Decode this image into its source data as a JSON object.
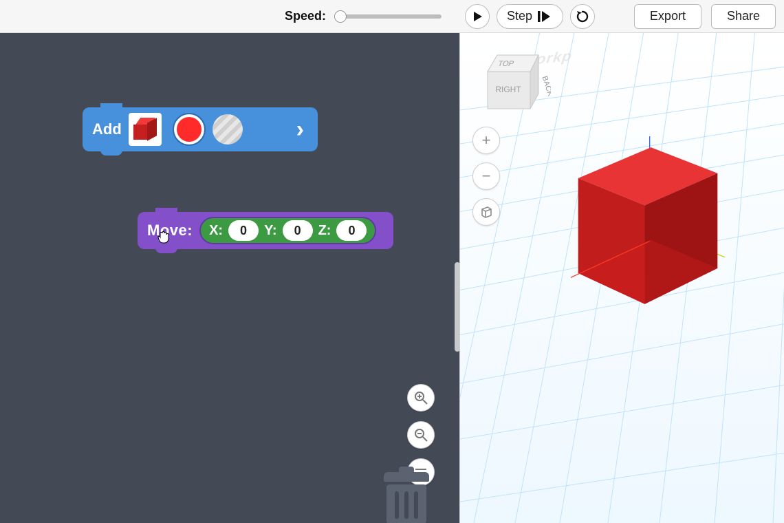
{
  "toolbar": {
    "speed_label": "Speed:",
    "speed_value": 0,
    "play_label": "Play",
    "step_label": "Step",
    "reset_label": "Reset",
    "export_label": "Export",
    "share_label": "Share"
  },
  "blocks": {
    "add": {
      "label": "Add",
      "shape": "box",
      "color_swatch": "#ff2b2b",
      "hole_selected": false
    },
    "move": {
      "label": "Move:",
      "x_label": "X:",
      "y_label": "Y:",
      "z_label": "Z:",
      "x": "0",
      "y": "0",
      "z": "0"
    }
  },
  "block_canvas": {
    "zoom_in_label": "Zoom in",
    "zoom_out_label": "Zoom out",
    "center_label": "Center",
    "trash_label": "Trash"
  },
  "viewport": {
    "viewcube": {
      "top": "TOP",
      "right": "RIGHT",
      "back": "BACK"
    },
    "controls": {
      "zoom_in": "+",
      "zoom_out": "−",
      "home": "home"
    },
    "object": {
      "type": "box",
      "color": "#d02020"
    },
    "watermark": "Workp"
  }
}
